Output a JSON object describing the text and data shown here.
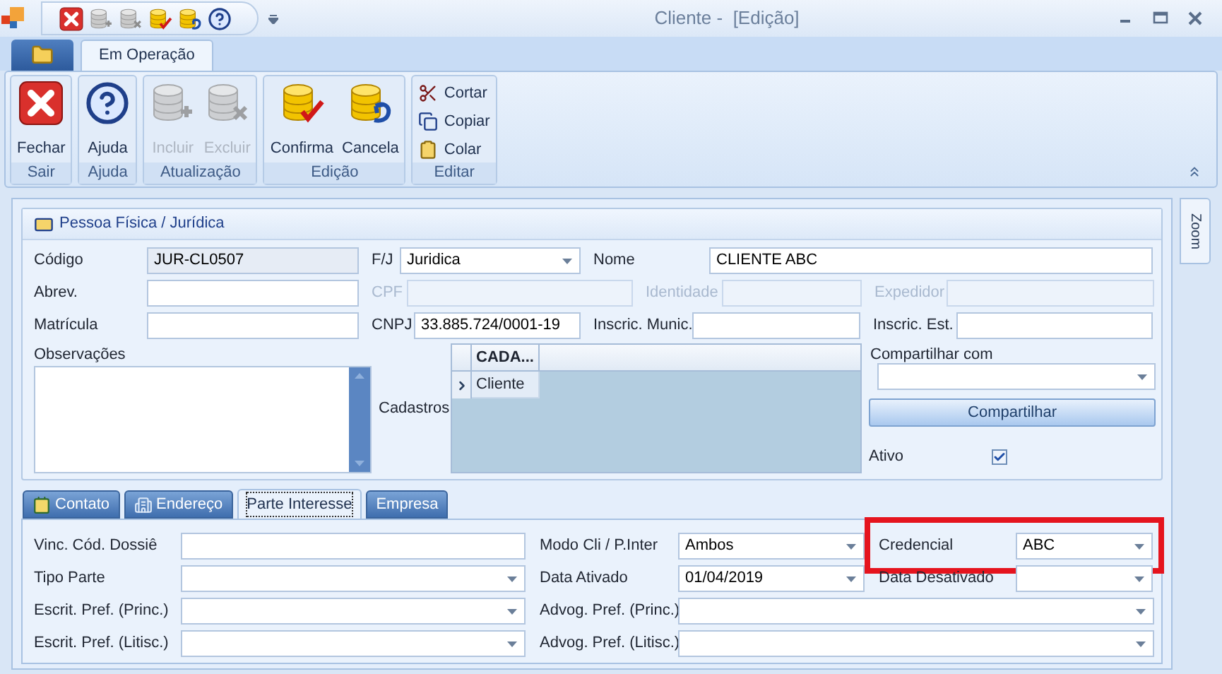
{
  "window": {
    "title": "Cliente -  [Edição]"
  },
  "ribbon": {
    "tabs": [
      {
        "label": "Em Operação",
        "selected": true
      }
    ],
    "groups": [
      {
        "label": "Sair",
        "kind": "large",
        "buttons": [
          {
            "label": "Fechar",
            "disabled": false
          }
        ]
      },
      {
        "label": "Ajuda",
        "kind": "large",
        "buttons": [
          {
            "label": "Ajuda",
            "disabled": false
          }
        ]
      },
      {
        "label": "Atualização",
        "kind": "large",
        "buttons": [
          {
            "label": "Incluir",
            "disabled": true
          },
          {
            "label": "Excluir",
            "disabled": true
          }
        ]
      },
      {
        "label": "Edição",
        "kind": "large",
        "buttons": [
          {
            "label": "Confirma",
            "disabled": false
          },
          {
            "label": "Cancela",
            "disabled": false
          }
        ]
      },
      {
        "label": "Editar",
        "kind": "small",
        "buttons": [
          {
            "label": "Cortar",
            "disabled": false
          },
          {
            "label": "Copiar",
            "disabled": false
          },
          {
            "label": "Colar",
            "disabled": false
          }
        ]
      }
    ]
  },
  "side_tab": {
    "label": "Zoom"
  },
  "person": {
    "title": "Pessoa Física / Jurídica",
    "rows": [
      [
        {
          "label": "Código",
          "value": "JUR-CL0507",
          "kind": "readonly",
          "disabled": false
        },
        {
          "label": "F/J",
          "value": "Juridica",
          "kind": "combo",
          "disabled": false
        },
        {
          "label": "Nome",
          "value": "CLIENTE ABC",
          "kind": "text",
          "disabled": false
        }
      ],
      [
        {
          "label": "Abrev.",
          "kind": "text",
          "disabled": false
        },
        {
          "label": "CPF",
          "kind": "text",
          "disabled": true
        },
        {
          "label": "Identidade",
          "kind": "text",
          "disabled": true
        },
        {
          "label": "Expedidor",
          "kind": "text",
          "disabled": true
        }
      ],
      [
        {
          "label": "Matrícula",
          "kind": "text",
          "disabled": false
        },
        {
          "label": "CNPJ",
          "value": "33.885.724/0001-19",
          "kind": "text",
          "disabled": false
        },
        {
          "label": "Inscric. Munic.",
          "kind": "text",
          "disabled": false
        },
        {
          "label": "Inscric. Est.",
          "kind": "text",
          "disabled": false
        }
      ]
    ],
    "notes": {
      "label": "Observações"
    },
    "registrations": {
      "label": "Cadastros",
      "columns": [
        "CADA..."
      ],
      "rows": [
        {
          "cells": [
            "Cliente"
          ],
          "selected": true
        }
      ]
    },
    "share": {
      "label": "Compartilhar com",
      "button": "Compartilhar"
    },
    "active": {
      "label": "Ativo",
      "checked": true
    }
  },
  "tabs": [
    {
      "label": "Contato",
      "selected": false
    },
    {
      "label": "Endereço",
      "selected": false
    },
    {
      "label": "Parte Interesse",
      "selected": true
    },
    {
      "label": "Empresa",
      "selected": false
    }
  ],
  "interest": {
    "rows": [
      [
        {
          "label": "Vinc. Cód. Dossiê",
          "kind": "text",
          "highlighted": false
        },
        {
          "label": "Modo Cli / P.Inter",
          "value": "Ambos",
          "kind": "combo",
          "highlighted": false
        },
        {
          "label": "Credencial",
          "value": "ABC",
          "kind": "combo",
          "highlighted": true
        }
      ],
      [
        {
          "label": "Tipo Parte",
          "kind": "combo",
          "highlighted": false
        },
        {
          "label": "Data Ativado",
          "value": "01/04/2019",
          "kind": "combo",
          "highlighted": false
        },
        {
          "label": "Data Desativado",
          "kind": "combo",
          "highlighted": false
        }
      ],
      [
        {
          "label": "Escrit. Pref. (Princ.)",
          "kind": "combo",
          "highlighted": false
        },
        {
          "label": "Advog. Pref. (Princ.)",
          "kind": "combo",
          "highlighted": false
        }
      ],
      [
        {
          "label": "Escrit. Pref. (Litisc.)",
          "kind": "combo",
          "highlighted": false
        },
        {
          "label": "Advog. Pref. (Litisc.)",
          "kind": "combo",
          "highlighted": false
        }
      ]
    ]
  }
}
